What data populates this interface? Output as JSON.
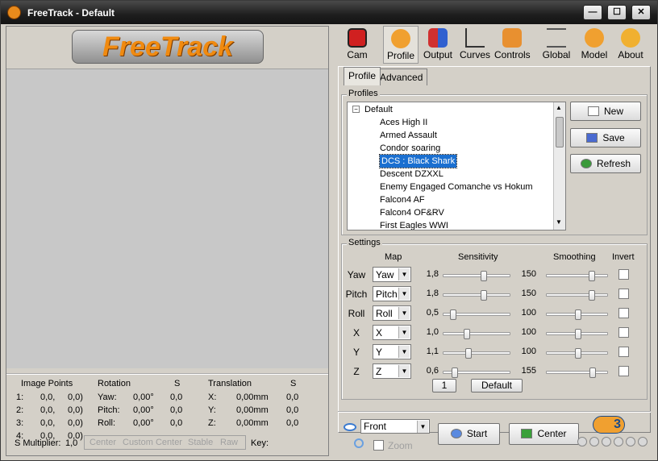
{
  "window": {
    "title": "FreeTrack - Default",
    "minimize": "—",
    "maximize": "☐",
    "close": "✕"
  },
  "logo": {
    "text": "FreeTrack"
  },
  "toolbar": [
    {
      "label": "Cam",
      "icon": "camera-icon"
    },
    {
      "label": "Profile",
      "icon": "profile-icon"
    },
    {
      "label": "Output",
      "icon": "output-icon"
    },
    {
      "label": "Curves",
      "icon": "curves-icon"
    },
    {
      "label": "Controls",
      "icon": "controls-icon"
    },
    {
      "label": "Global",
      "icon": "sliders-icon"
    },
    {
      "label": "Model",
      "icon": "model-icon"
    },
    {
      "label": "About",
      "icon": "help-icon"
    }
  ],
  "tabs": [
    "Profile",
    "Advanced"
  ],
  "profiles": {
    "group_title": "Profiles",
    "root": "Default",
    "items": [
      "Aces High II",
      "Armed Assault",
      "Condor soaring",
      "DCS : Black Shark",
      "Descent DZXXL",
      "Enemy Engaged Comanche vs Hokum",
      "Falcon4 AF",
      "Falcon4 OF&RV",
      "First Eagles WWI"
    ],
    "selected": "DCS : Black Shark"
  },
  "buttons": {
    "new": "New",
    "save": "Save",
    "refresh": "Refresh"
  },
  "settings": {
    "group_title": "Settings",
    "headers": {
      "map": "Map",
      "sensitivity": "Sensitivity",
      "smoothing": "Smoothing",
      "invert": "Invert"
    },
    "rows": [
      {
        "label": "Yaw",
        "map": "Yaw",
        "sensitivity": "1,8",
        "sens_pos": 0.6,
        "smoothing": "150",
        "smooth_pos": 0.75,
        "invert": false
      },
      {
        "label": "Pitch",
        "map": "Pitch",
        "sensitivity": "1,8",
        "sens_pos": 0.6,
        "smoothing": "150",
        "smooth_pos": 0.75,
        "invert": false
      },
      {
        "label": "Roll",
        "map": "Roll",
        "sensitivity": "0,5",
        "sens_pos": 0.1,
        "smoothing": "100",
        "smooth_pos": 0.5,
        "invert": false
      },
      {
        "label": "X",
        "map": "X",
        "sensitivity": "1,0",
        "sens_pos": 0.33,
        "smoothing": "100",
        "smooth_pos": 0.5,
        "invert": false
      },
      {
        "label": "Y",
        "map": "Y",
        "sensitivity": "1,1",
        "sens_pos": 0.36,
        "smoothing": "100",
        "smooth_pos": 0.5,
        "invert": false
      },
      {
        "label": "Z",
        "map": "Z",
        "sensitivity": "0,6",
        "sens_pos": 0.13,
        "smoothing": "155",
        "smooth_pos": 0.77,
        "invert": false
      }
    ],
    "page_button": "1",
    "default_button": "Default"
  },
  "bottom": {
    "view": "Front",
    "zoom": "Zoom",
    "start": "Start",
    "center": "Center",
    "brand": "3"
  },
  "status": {
    "image_points_label": "Image Points",
    "points": [
      {
        "i": "1:",
        "x": "0,0,",
        "y": "0,0)"
      },
      {
        "i": "2:",
        "x": "0,0,",
        "y": "0,0)"
      },
      {
        "i": "3:",
        "x": "0,0,",
        "y": "0,0)"
      },
      {
        "i": "4:",
        "x": "0,0,",
        "y": "0,0)"
      }
    ],
    "rotation_label": "Rotation",
    "s_label": "S",
    "rotation": [
      {
        "axis": "Yaw:",
        "value": "0,00°",
        "s": "0,0"
      },
      {
        "axis": "Pitch:",
        "value": "0,00°",
        "s": "0,0"
      },
      {
        "axis": "Roll:",
        "value": "0,00°",
        "s": "0,0"
      }
    ],
    "translation_label": "Translation",
    "translation": [
      {
        "axis": "X:",
        "value": "0,00mm",
        "s": "0,0"
      },
      {
        "axis": "Y:",
        "value": "0,00mm",
        "s": "0,0"
      },
      {
        "axis": "Z:",
        "value": "0,00mm",
        "s": "0,0"
      }
    ],
    "s_multiplier_label": "S Multiplier:",
    "s_multiplier": "1,0",
    "center": "Center",
    "custom_center": "Custom Center",
    "stable": "Stable",
    "raw": "Raw",
    "key": "Key:"
  }
}
